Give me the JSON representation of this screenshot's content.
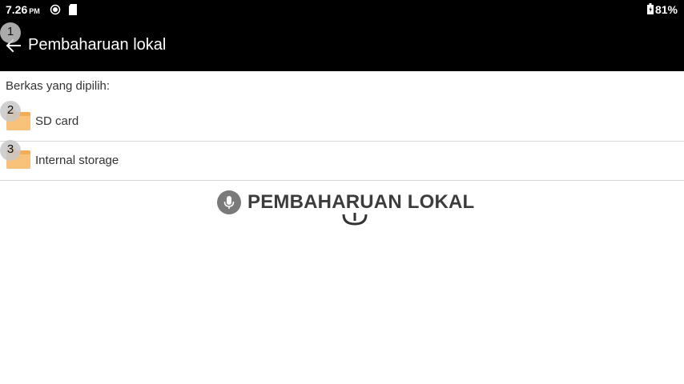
{
  "status_bar": {
    "time": "7.26",
    "ampm": "PM",
    "battery": "81%"
  },
  "toolbar": {
    "title": "Pembaharuan lokal"
  },
  "content": {
    "files_label": "Berkas yang dipilih:",
    "items": [
      {
        "label": "SD card",
        "icon": "folder-icon"
      },
      {
        "label": "Internal storage",
        "icon": "folder-icon"
      }
    ]
  },
  "markers": [
    "1",
    "2",
    "3"
  ],
  "banner": {
    "text": "PEMBAHARUAN LOKAL",
    "icon": "microphone-icon"
  },
  "colors": {
    "bar": "#000000",
    "folder": "#f5b562",
    "divider": "#d8d8d8"
  }
}
